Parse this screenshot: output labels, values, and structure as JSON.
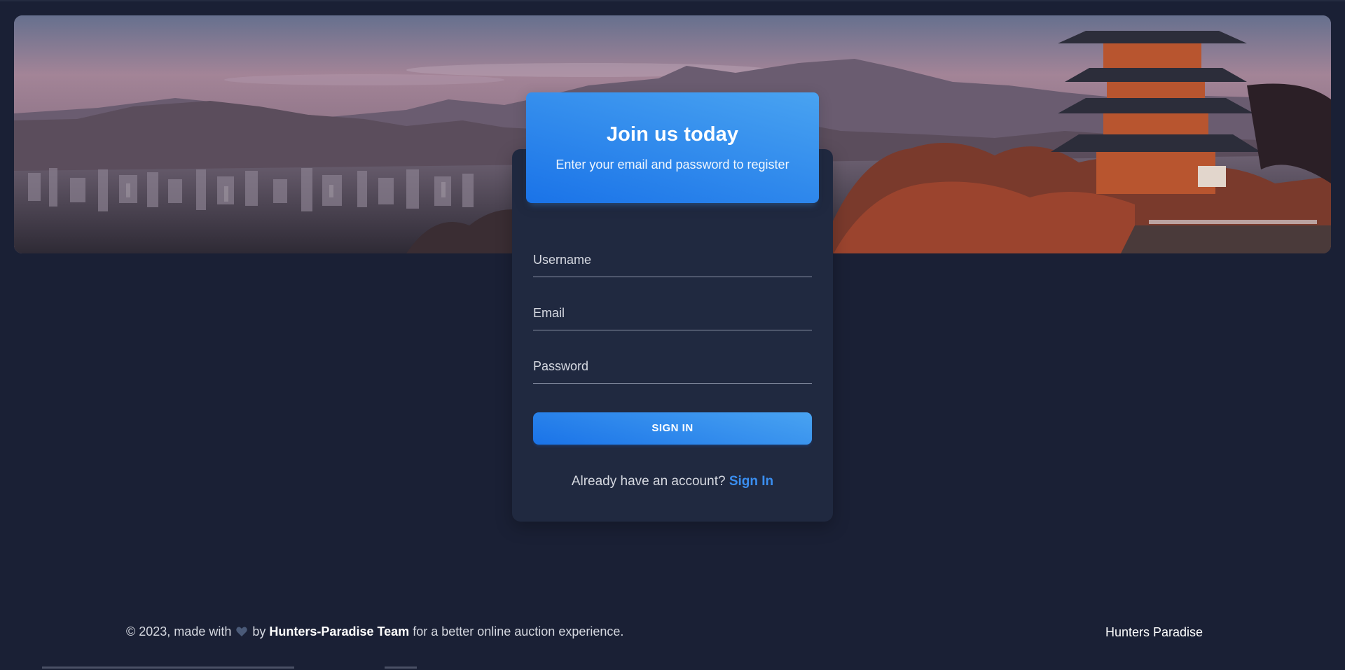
{
  "hero": {
    "image_alt": "Kyoto cityscape with pagoda and mountains at dusk"
  },
  "card": {
    "title": "Join us today",
    "subtitle": "Enter your email and password to register",
    "fields": [
      {
        "label": "Username",
        "value": ""
      },
      {
        "label": "Email",
        "value": ""
      },
      {
        "label": "Password",
        "value": ""
      }
    ],
    "submit_label": "SIGN IN",
    "signin_prompt": "Already have an account?",
    "signin_link": "Sign In"
  },
  "footer": {
    "copyright_prefix": "© 2023, made with",
    "by": "by",
    "team": "Hunters-Paradise Team",
    "suffix": "for a better online auction experience.",
    "brand": "Hunters Paradise"
  },
  "colors": {
    "background": "#1a2035",
    "card": "#202940",
    "accent_start": "#49a3f1",
    "accent_end": "#1a73e8",
    "link": "#3a8ef0",
    "heart": "#4a5a78"
  },
  "icons": {
    "heart": "heart-icon"
  }
}
